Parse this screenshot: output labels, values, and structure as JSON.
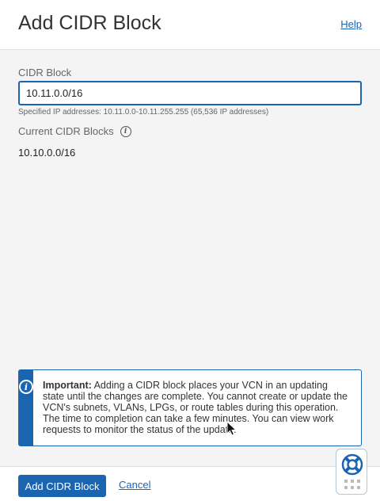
{
  "header": {
    "title": "Add CIDR Block",
    "help_label": "Help"
  },
  "form": {
    "cidr_label": "CIDR Block",
    "cidr_value": "10.11.0.0/16",
    "cidr_hint": "Specified IP addresses: 10.11.0.0-10.11.255.255 (65,536 IP addresses)",
    "current_label": "Current CIDR Blocks",
    "current_value": "10.10.0.0/16"
  },
  "notice": {
    "strong": "Important:",
    "text": " Adding a CIDR block places your VCN in an updating state until the changes are complete. You cannot create or update the VCN's subnets, VLANs, LPGs, or route tables during this operation. The time to completion can take a few minutes. You can view work requests to monitor the status of the update."
  },
  "footer": {
    "primary_label": "Add CIDR Block",
    "cancel_label": "Cancel"
  },
  "icons": {
    "info": "info-icon",
    "help": "lifebuoy-icon",
    "grip": "grip-icon"
  },
  "colors": {
    "accent": "#1a64b0"
  }
}
